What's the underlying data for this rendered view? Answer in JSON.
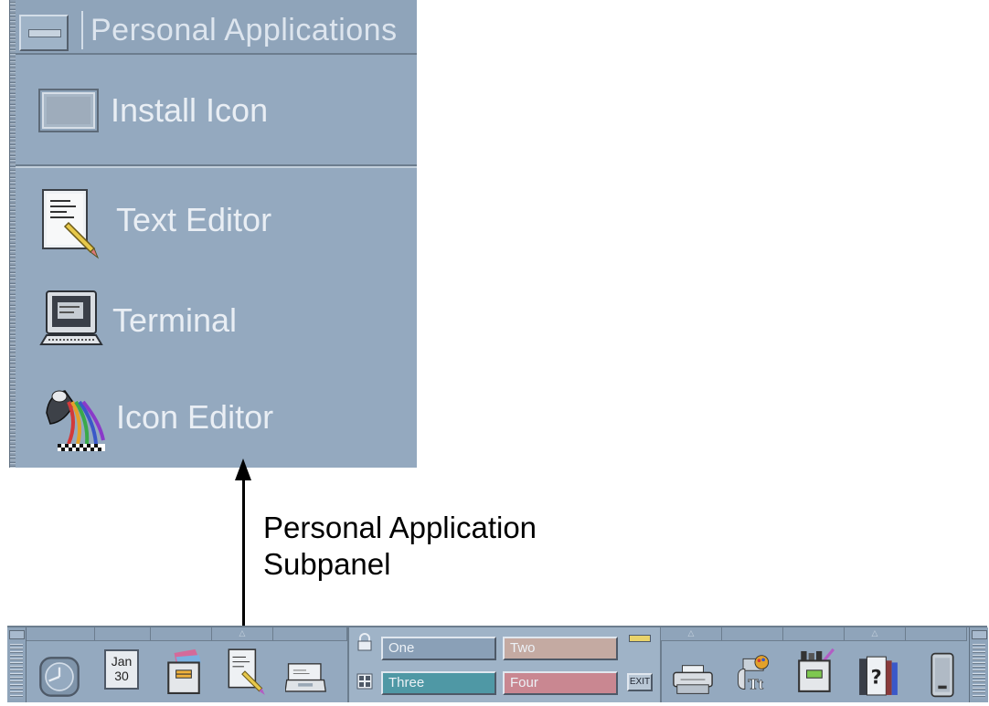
{
  "subpanel": {
    "title": "Personal Applications",
    "install_label": "Install Icon",
    "items": [
      {
        "label": "Text Editor",
        "icon": "text-editor-icon"
      },
      {
        "label": "Terminal",
        "icon": "terminal-icon"
      },
      {
        "label": "Icon Editor",
        "icon": "icon-editor-icon"
      }
    ]
  },
  "caption": {
    "line1": "Personal Application",
    "line2": "Subpanel"
  },
  "front_panel": {
    "calendar": {
      "month": "Jan",
      "day": "30"
    },
    "workspaces": [
      {
        "label": "One",
        "color": "#8aa0b7"
      },
      {
        "label": "Two",
        "color": "#c4aaa2"
      },
      {
        "label": "Three",
        "color": "#4f98a5"
      },
      {
        "label": "Four",
        "color": "#c98791"
      }
    ],
    "exit_label": "EXIT"
  },
  "colors": {
    "panel": "#94a9bf",
    "highlight": "#e0e7ef",
    "shadow": "#4e5967"
  }
}
